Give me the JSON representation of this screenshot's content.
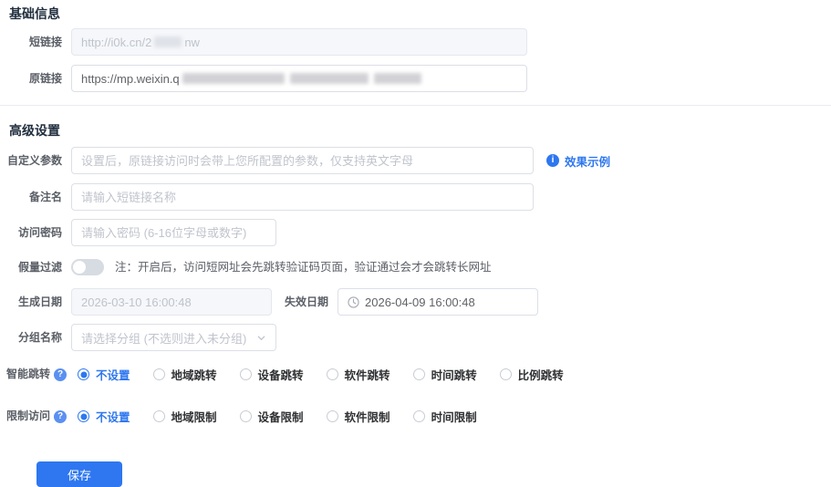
{
  "accent_color": "#2e77f0",
  "basic": {
    "title": "基础信息",
    "short_link": {
      "label": "短链接",
      "value_prefix": "http://i0k.cn/2",
      "value_suffix": "nw"
    },
    "original_link": {
      "label": "原链接",
      "value_prefix": "https://mp.weixin.q"
    }
  },
  "advanced": {
    "title": "高级设置",
    "custom_param": {
      "label": "自定义参数",
      "placeholder": "设置后，原链接访问时会带上您所配置的参数，仅支持英文字母",
      "example_link_label": "效果示例"
    },
    "remark_name": {
      "label": "备注名",
      "placeholder": "请输入短链接名称"
    },
    "access_password": {
      "label": "访问密码",
      "placeholder": "请输入密码 (6-16位字母或数字)"
    },
    "fake_traffic_filter": {
      "label": "假量过滤",
      "state": "off",
      "note": "注：开启后，访问短网址会先跳转验证码页面，验证通过会才会跳转长网址"
    },
    "create_date": {
      "label": "生成日期",
      "value": "2026-03-10 16:00:48"
    },
    "expire_date": {
      "label": "失效日期",
      "value": "2026-04-09 16:00:48"
    },
    "group_name": {
      "label": "分组名称",
      "placeholder": "请选择分组 (不选则进入未分组)"
    },
    "smart_jump": {
      "label": "智能跳转",
      "selected": 0,
      "options": [
        "不设置",
        "地域跳转",
        "设备跳转",
        "软件跳转",
        "时间跳转",
        "比例跳转"
      ]
    },
    "restrict_access": {
      "label": "限制访问",
      "selected": 0,
      "options": [
        "不设置",
        "地域限制",
        "设备限制",
        "软件限制",
        "时间限制"
      ]
    }
  },
  "save_button_label": "保存"
}
